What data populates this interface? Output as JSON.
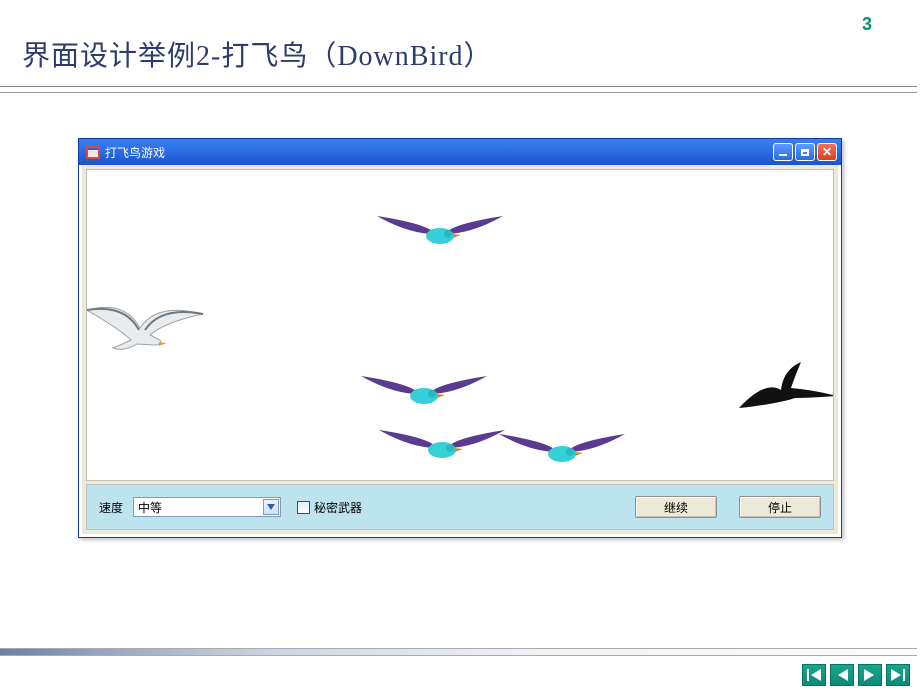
{
  "slide": {
    "number": "3",
    "title": "界面设计举例2-打飞鸟（DownBird）"
  },
  "window": {
    "title": "打飞鸟游戏",
    "controls": {
      "speed_label": "速度",
      "speed_value": "中等",
      "secret_weapon_label": "秘密武器",
      "continue_label": "继续",
      "stop_label": "停止"
    }
  },
  "icons": {
    "minimize": "minimize-icon",
    "maximize": "maximize-icon",
    "close": "close-icon",
    "app": "form-icon",
    "chevron_down": "chevron-down-icon"
  },
  "nav": {
    "first": "first-icon",
    "prev": "prev-icon",
    "next": "next-icon",
    "last": "last-icon"
  }
}
